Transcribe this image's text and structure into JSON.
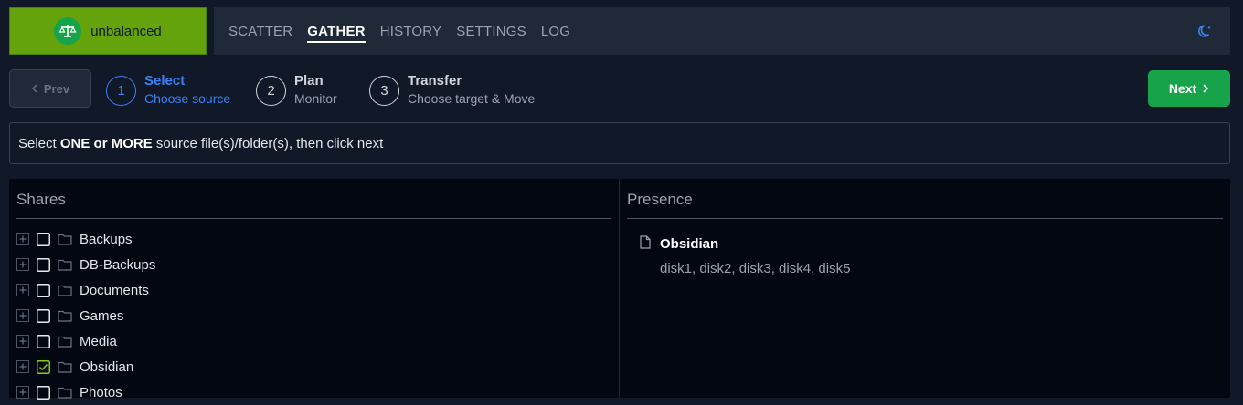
{
  "app": {
    "name": "unbalanced"
  },
  "nav": {
    "items": [
      {
        "label": "SCATTER",
        "active": false
      },
      {
        "label": "GATHER",
        "active": true
      },
      {
        "label": "HISTORY",
        "active": false
      },
      {
        "label": "SETTINGS",
        "active": false
      },
      {
        "label": "LOG",
        "active": false
      }
    ],
    "theme_icon": "moon-icon"
  },
  "stepper": {
    "prev_label": "Prev",
    "next_label": "Next",
    "steps": [
      {
        "number": "1",
        "title": "Select",
        "subtitle": "Choose source",
        "active": true
      },
      {
        "number": "2",
        "title": "Plan",
        "subtitle": "Monitor",
        "active": false
      },
      {
        "number": "3",
        "title": "Transfer",
        "subtitle": "Choose target & Move",
        "active": false
      }
    ]
  },
  "instruction": {
    "prefix": "Select ",
    "emphasis": "ONE or MORE",
    "suffix": " source file(s)/folder(s), then click next"
  },
  "shares": {
    "title": "Shares",
    "items": [
      {
        "name": "Backups",
        "checked": false
      },
      {
        "name": "DB-Backups",
        "checked": false
      },
      {
        "name": "Documents",
        "checked": false
      },
      {
        "name": "Games",
        "checked": false
      },
      {
        "name": "Media",
        "checked": false
      },
      {
        "name": "Obsidian",
        "checked": true
      },
      {
        "name": "Photos",
        "checked": false
      }
    ]
  },
  "presence": {
    "title": "Presence",
    "item": {
      "name": "Obsidian",
      "disks": "disk1, disk2, disk3, disk4, disk5"
    }
  },
  "colors": {
    "brand": "#65a30d",
    "accent": "#3b82f6",
    "next": "#16a34a",
    "checked": "#84cc16"
  }
}
